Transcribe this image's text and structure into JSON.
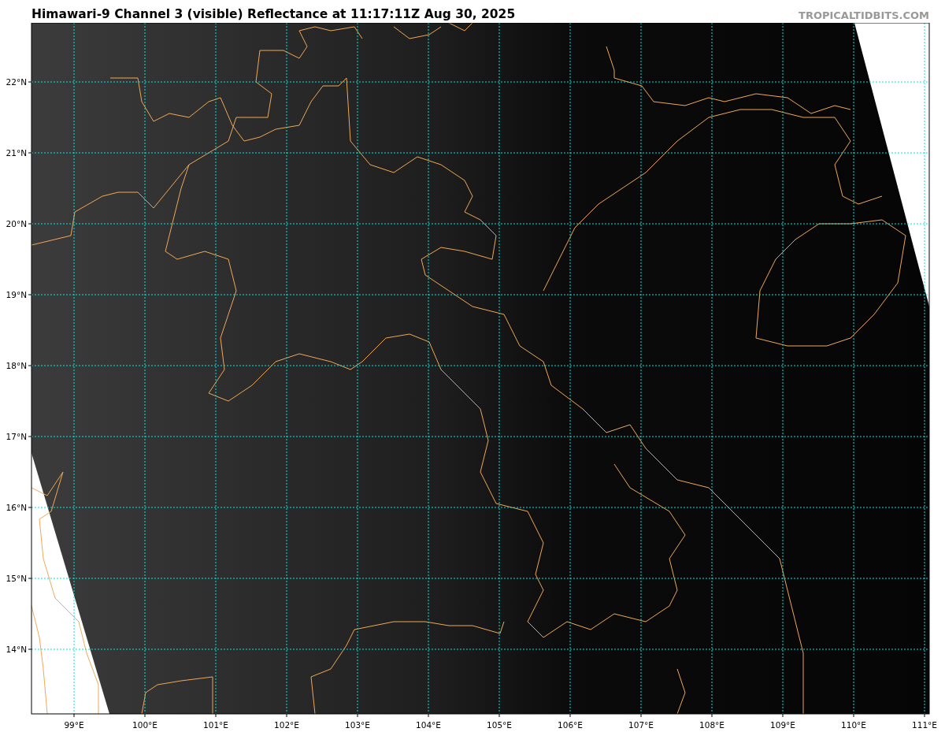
{
  "title": "Himawari-9 Channel 3 (visible) Reflectance at 11:17:11Z Aug 30, 2025",
  "site_credit": "TROPICALTIDBITS.COM",
  "map": {
    "x_ticks": [
      "99°E",
      "100°E",
      "101°E",
      "102°E",
      "103°E",
      "104°E",
      "105°E",
      "106°E",
      "107°E",
      "108°E",
      "109°E",
      "110°E",
      "111°E"
    ],
    "y_ticks": [
      "22°N",
      "21°N",
      "20°N",
      "19°N",
      "18°N",
      "17°N",
      "16°N",
      "15°N",
      "14°N"
    ]
  }
}
